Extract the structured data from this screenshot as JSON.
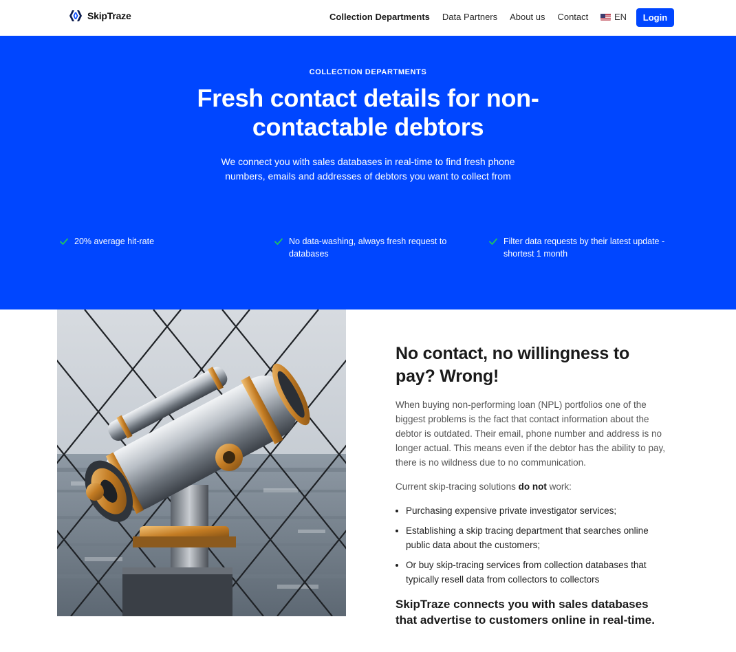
{
  "header": {
    "brand": "SkipTraze",
    "nav": [
      {
        "label": "Collection Departments",
        "active": true
      },
      {
        "label": "Data Partners",
        "active": false
      },
      {
        "label": "About us",
        "active": false
      },
      {
        "label": "Contact",
        "active": false
      }
    ],
    "language": "EN",
    "login_label": "Login"
  },
  "hero": {
    "eyebrow": "COLLECTION DEPARTMENTS",
    "title": "Fresh contact details for non-contactable debtors",
    "subtitle": "We connect you with sales databases in real-time to find fresh phone numbers, emails and addresses of debtors you want to collect from",
    "features": [
      "20% average hit-rate",
      "No data-washing, always fresh request to databases",
      "Filter data requests by their latest update - shortest 1 month"
    ]
  },
  "section": {
    "title": "No contact, no willingness to pay? Wrong!",
    "paragraph": "When buying non-performing loan (NPL) portfolios one of the biggest problems is the fact that contact information about the debtor is outdated. Their email, phone number and address is no longer actual. This means even if the debtor has the ability to pay, there is no wildness due to no communication.",
    "intro_before": "Current skip-tracing solutions ",
    "intro_bold": "do not",
    "intro_after": " work:",
    "bullets": [
      "Purchasing expensive private investigator services;",
      "Establishing a skip tracing department that searches online public data about the customers;",
      "Or buy skip-tracing services from collection databases that typically resell data from collectors to collectors"
    ],
    "closing": "SkipTraze connects you with sales databases that advertise to customers online in real-time."
  },
  "colors": {
    "brand_blue": "#0046ff",
    "check_green": "#22c55e"
  },
  "icons": {
    "logo": "skiptraze-logo-icon",
    "flag": "us-flag-icon",
    "check": "check-icon"
  }
}
